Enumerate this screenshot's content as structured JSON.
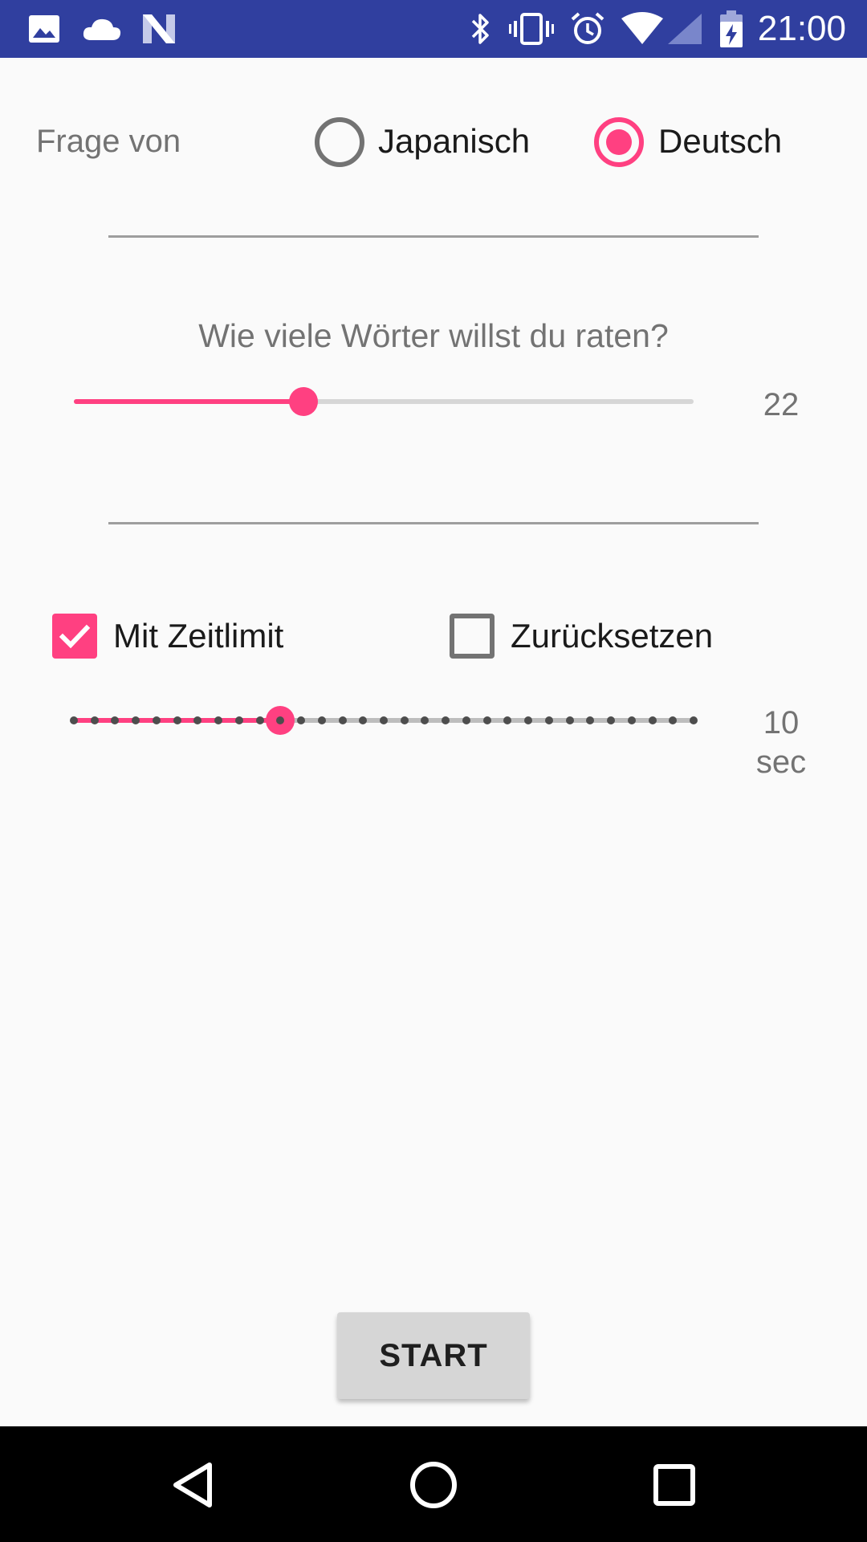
{
  "status_bar": {
    "time": "21:00",
    "left_icons": [
      "image-icon",
      "cloud-icon",
      "n-icon"
    ],
    "right_icons": [
      "bluetooth-icon",
      "vibrate-icon",
      "alarm-icon",
      "wifi-icon",
      "signal-icon",
      "battery-charging-icon"
    ],
    "background": "#303f9f"
  },
  "question_source": {
    "label": "Frage von",
    "options": [
      {
        "label": "Japanisch",
        "checked": false
      },
      {
        "label": "Deutsch",
        "checked": true
      }
    ]
  },
  "word_count": {
    "question": "Wie viele Wörter willst du raten?",
    "value": "22",
    "slider_fraction": 0.37
  },
  "time_limit": {
    "with_limit_label": "Mit Zeitlimit",
    "with_limit_checked": true,
    "reset_label": "Zurücksetzen",
    "reset_checked": false,
    "value": "10",
    "unit": "sec",
    "step_index": 10,
    "step_count": 31
  },
  "start_button": {
    "label": "START"
  },
  "colors": {
    "accent": "#ff4081",
    "primary_dark": "#303f9f",
    "secondary_text": "#737373"
  },
  "nav_bar": {
    "icons": [
      "back-icon",
      "home-icon",
      "recents-icon"
    ]
  }
}
